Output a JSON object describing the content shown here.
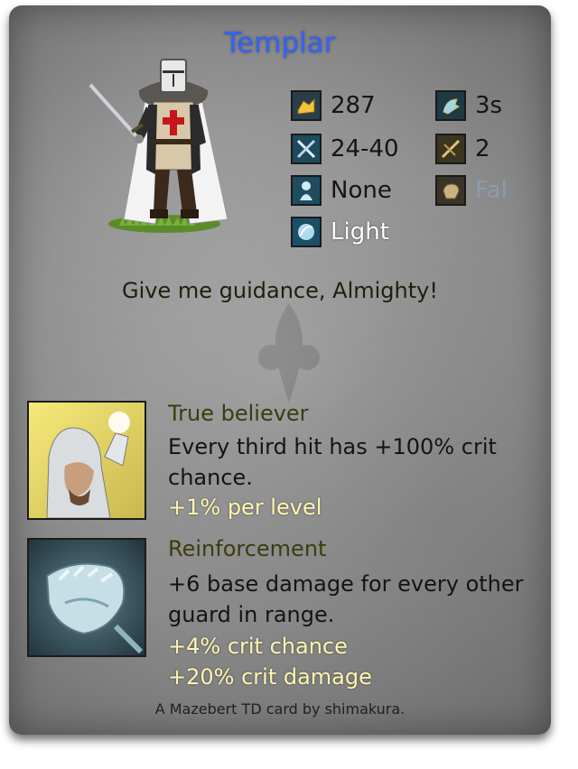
{
  "card": {
    "title": "Templar",
    "quote": "Give me guidance, Almighty!",
    "credit": "A Mazebert TD card by shimakura."
  },
  "stats": {
    "cost": {
      "icon": "gold-icon",
      "value": "287"
    },
    "attack_speed": {
      "icon": "speed-icon",
      "value": "3s"
    },
    "damage": {
      "icon": "swords-icon",
      "value": "24-40"
    },
    "range": {
      "icon": "crossbow-icon",
      "value": "2"
    },
    "gender": {
      "icon": "figure-icon",
      "value": "None"
    },
    "attack_type": {
      "icon": "fist-icon",
      "value": "Fal"
    },
    "element": {
      "icon": "light-element-icon",
      "value": "Light"
    }
  },
  "abilities": [
    {
      "name": "True believer",
      "description": "Every third hit has +100% crit chance.",
      "bonuses": [
        "+1% per level"
      ]
    },
    {
      "name": "Reinforcement",
      "description": "+6 base damage for every other guard in range.",
      "bonuses": [
        "+4% crit chance",
        "+20% crit damage"
      ]
    }
  ],
  "colors": {
    "title": "#2f63ff",
    "ability_name": "#3b3c10",
    "bonus": "#fff6b0"
  }
}
